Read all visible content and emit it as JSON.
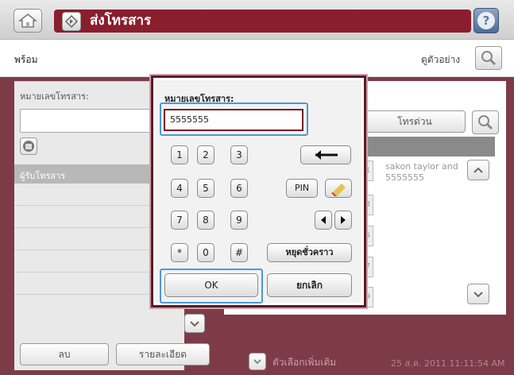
{
  "header": {
    "title": "ส่งโทรสาร",
    "home_icon": "home-icon",
    "send_icon": "send-fax-icon",
    "help_icon": "help-icon"
  },
  "status": {
    "text": "พร้อม",
    "preview_label": "ดูตัวอย่าง"
  },
  "left": {
    "fax_label": "หมายเลขโทรสาร:",
    "recipient_header": "ผู้รับโทรสาร",
    "delete_label": "ลบ",
    "details_label": "รายละเอียด"
  },
  "right": {
    "speed_dial_label": "โทรด่วน",
    "entry_name": "sakon taylor and",
    "entry_number": "5555555",
    "cells": [
      "1",
      "3",
      "5",
      "7",
      "9"
    ]
  },
  "dialog": {
    "label": "หมายเลขโทรสาร:",
    "value": "5555555",
    "keys": [
      "1",
      "2",
      "3",
      "4",
      "5",
      "6",
      "7",
      "8",
      "9",
      "*",
      "0",
      "#"
    ],
    "pin_label": "PIN",
    "pause_label": "หยุดชั่วคราว",
    "ok_label": "OK",
    "cancel_label": "ยกเลิก"
  },
  "footer": {
    "more_options": "ตัวเลือกเพิ่มเติม",
    "timestamp": "25 ส.ค. 2011 11:11:54 AM"
  }
}
